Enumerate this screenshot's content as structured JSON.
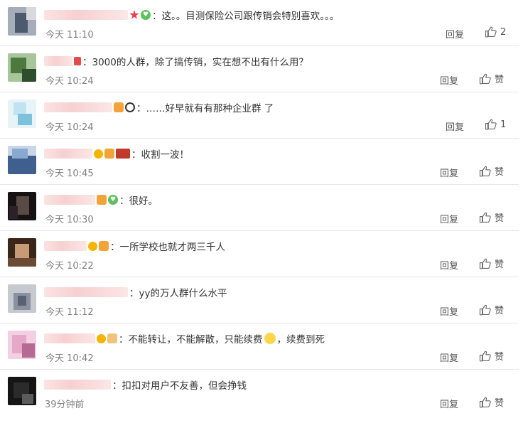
{
  "comments": [
    {
      "text": "：这。。目测保险公司跟传销会特别喜欢。。。",
      "time": "今天 11:10",
      "reply": "回复",
      "like": "2",
      "like_is_count": true,
      "avatar": [
        "#4d5a6e",
        "#d7d9dc",
        "#a5adb8"
      ]
    },
    {
      "text": "：3000的人群，除了搞传销，实在想不出有什么用？",
      "time": "今天 10:24",
      "reply": "回复",
      "like": "赞",
      "like_is_count": false,
      "avatar": [
        "#4c7a3e",
        "#a8c59b",
        "#2e4d2a"
      ]
    },
    {
      "text": "：……好早就有有那种企业群 了",
      "time": "今天 10:24",
      "reply": "回复",
      "like": "1",
      "like_is_count": true,
      "avatar": [
        "#bfe3f1",
        "#e8f3f8",
        "#7cc2dd"
      ]
    },
    {
      "text": "：收割一波！",
      "time": "今天 10:45",
      "reply": "回复",
      "like": "赞",
      "like_is_count": false,
      "avatar": [
        "#8aa9cf",
        "#3f5f8e",
        "#c9d6e7"
      ]
    },
    {
      "text": "：很好。",
      "time": "今天 10:30",
      "reply": "回复",
      "like": "赞",
      "like_is_count": false,
      "avatar": [
        "#2a2226",
        "#5a4a46",
        "#161214"
      ]
    },
    {
      "text": "：一所学校也就才两三千人",
      "time": "今天 10:22",
      "reply": "回复",
      "like": "赞",
      "like_is_count": false,
      "avatar": [
        "#6b4a33",
        "#c79b76",
        "#3b2719"
      ]
    },
    {
      "text": "：yy的万人群什么水平",
      "time": "今天 11:12",
      "reply": "回复",
      "like": "赞",
      "like_is_count": false,
      "avatar": [
        "#5a6170",
        "#c6c9d0",
        "#8a91a0"
      ]
    },
    {
      "text": "：不能转让，不能解散，只能续费",
      "text2": "，续费到死",
      "time": "今天 10:42",
      "reply": "回复",
      "like": "赞",
      "like_is_count": false,
      "avatar": [
        "#e7a8c8",
        "#b46a93",
        "#f2d0e1"
      ]
    },
    {
      "text": "：扣扣对用户不友善，但会挣钱",
      "time": "39分钟前",
      "reply": "回复",
      "like": "赞",
      "like_is_count": false,
      "avatar": [
        "#2b2b2b",
        "#5b5b5b",
        "#151515"
      ]
    }
  ],
  "icons": {
    "like": "thumbs-up-icon"
  },
  "colors": {
    "text": "#333333",
    "meta": "#808080",
    "divider": "#e6e6e6"
  }
}
